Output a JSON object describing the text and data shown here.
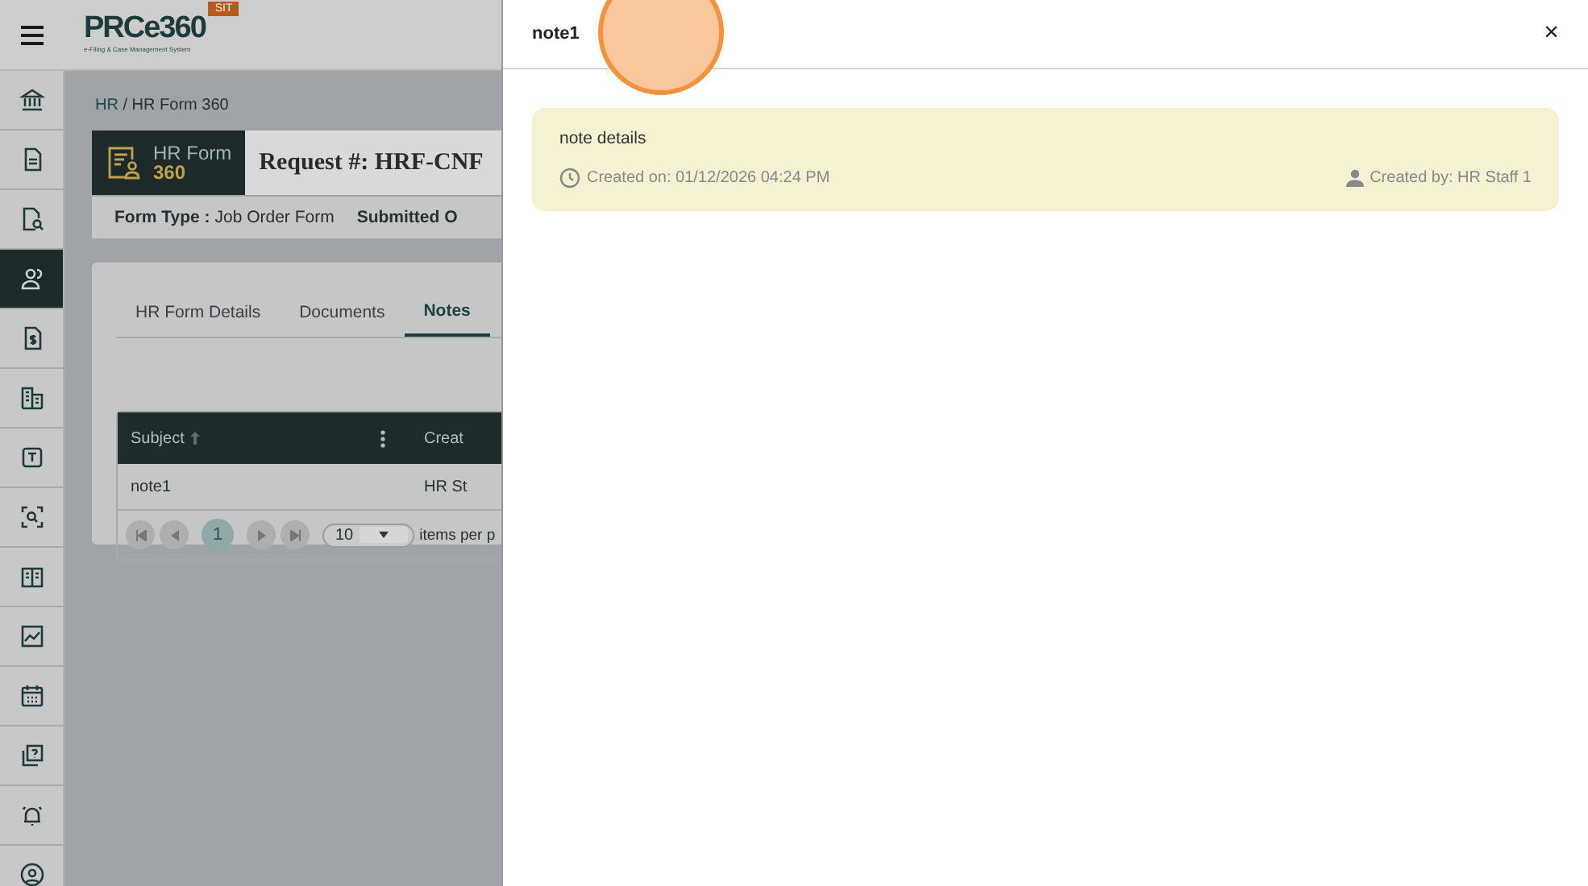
{
  "header": {
    "logo": "PRCe360",
    "logo_subtitle": "e-Filing & Case Management System",
    "env_badge": "SIT"
  },
  "sidebar": {
    "items": [
      {
        "selected": false
      },
      {
        "selected": false
      },
      {
        "selected": false
      },
      {
        "selected": true
      },
      {
        "selected": false
      },
      {
        "selected": false
      },
      {
        "selected": false
      },
      {
        "selected": false
      },
      {
        "selected": false
      },
      {
        "selected": false
      },
      {
        "selected": false
      },
      {
        "selected": false
      },
      {
        "selected": false
      },
      {
        "selected": false
      }
    ]
  },
  "breadcrumb": {
    "separator": "/",
    "items": [
      {
        "label": "HR",
        "link": true
      },
      {
        "label": "HR Form 360",
        "link": false
      }
    ]
  },
  "form_header": {
    "badge_line1": "HR Form",
    "badge_line2": "360",
    "title": "Request #: HRF-CNF"
  },
  "form_fields": [
    {
      "label": "Form Type :",
      "value": "Job Order Form"
    },
    {
      "label": "Submitted O"
    }
  ],
  "tabs": [
    {
      "label": "HR Form Details",
      "selected": false
    },
    {
      "label": "Documents",
      "selected": false
    },
    {
      "label": "Notes",
      "selected": true
    }
  ],
  "table": {
    "columns": [
      "Subject",
      "Creat"
    ],
    "rows": [
      [
        "note1",
        "HR St"
      ]
    ]
  },
  "pager": {
    "page": "1",
    "page_size": "10",
    "items_label": "items per p"
  },
  "drawer": {
    "title": "note1",
    "close": "×",
    "note": {
      "body": "note details",
      "created_on": "Created on: 01/12/2026 04:24 PM",
      "created_by": "Created by: HR Staff 1"
    }
  }
}
